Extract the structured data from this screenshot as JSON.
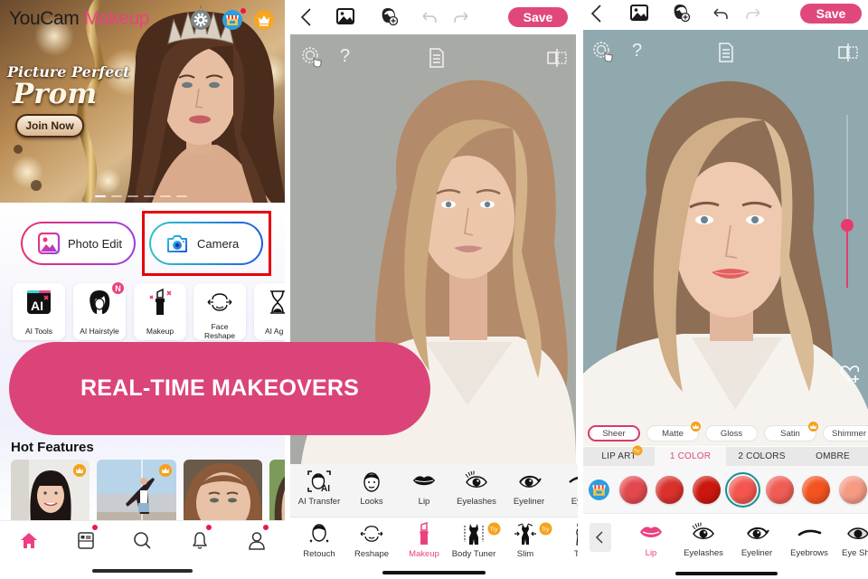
{
  "overlay_banner": {
    "text": "REAL-TIME MAKEOVERS",
    "color": "#db4479"
  },
  "colors": {
    "brand_pink": "#e0487c",
    "highlight_box": "#e8000b",
    "selected_ring": "#168f92",
    "premium_badge": "#f4a11d"
  },
  "home_screen": {
    "logo": {
      "part1": "YouCam",
      "part2": " Makeup"
    },
    "header_icons": [
      "settings-gear-icon",
      "store-icon",
      "premium-crown-icon"
    ],
    "hero": {
      "script_title": "Picture Perfect",
      "title": "Prom",
      "cta_label": "Join Now",
      "slide_count": 6,
      "active_slide": 1
    },
    "actions": [
      {
        "label": "Photo Edit",
        "icon": "photo-icon"
      },
      {
        "label": "Camera",
        "icon": "camera-icon",
        "highlighted": true
      }
    ],
    "features": [
      {
        "label": "AI Tools",
        "icon": "ai-tools-icon"
      },
      {
        "label": "AI Hairstyle",
        "icon": "hairstyle-icon",
        "badge": "N"
      },
      {
        "label": "Makeup",
        "icon": "lipstick-icon"
      },
      {
        "label_line1": "Face",
        "label_line2": "Reshape",
        "icon": "face-reshape-icon"
      },
      {
        "label": "AI Ag",
        "icon": "hourglass-icon"
      }
    ],
    "hot_features_title": "Hot Features",
    "hot_feature_cards": [
      {
        "premium": true
      },
      {
        "premium": true
      },
      {
        "premium": false
      },
      {
        "premium": false
      }
    ],
    "bottom_nav": [
      {
        "icon": "home-icon",
        "active": true
      },
      {
        "icon": "news-icon",
        "dot": true
      },
      {
        "icon": "search-icon"
      },
      {
        "icon": "bell-icon",
        "dot": true
      },
      {
        "icon": "profile-icon",
        "dot": true
      }
    ]
  },
  "editor_screen": {
    "save_label": "Save",
    "overlay_question": "?",
    "makeup_tools": [
      {
        "label": "AI Transfer"
      },
      {
        "label": "Looks"
      },
      {
        "label": "Lip"
      },
      {
        "label": "Eyelashes"
      },
      {
        "label": "Eyeliner"
      },
      {
        "label": "Eyel"
      }
    ],
    "categories": [
      {
        "label": "Retouch"
      },
      {
        "label": "Reshape"
      },
      {
        "label": "Makeup",
        "active": true
      },
      {
        "label": "Body Tuner",
        "badge": "Try"
      },
      {
        "label": "Slim",
        "badge": "Try"
      },
      {
        "label": "Tal"
      }
    ]
  },
  "lip_screen": {
    "save_label": "Save",
    "overlay_question": "?",
    "intensity_percent": 36,
    "finishes": [
      {
        "label": "Sheer",
        "selected": true
      },
      {
        "label": "Matte",
        "premium": true
      },
      {
        "label": "Gloss"
      },
      {
        "label": "Satin",
        "premium": true
      },
      {
        "label": "Shimmer"
      }
    ],
    "tabs": [
      {
        "label": "LIP ART",
        "badge": "Try"
      },
      {
        "label": "1 COLOR",
        "active": true
      },
      {
        "label": "2 COLORS"
      },
      {
        "label": "OMBRE"
      }
    ],
    "swatches": [
      {
        "color": "#e3484f"
      },
      {
        "color": "#d9312c"
      },
      {
        "color": "#cc170e"
      },
      {
        "color": "#f4564f",
        "selected": true
      },
      {
        "color": "#f05d55"
      },
      {
        "color": "#f4521f"
      },
      {
        "color": "#f69a84"
      }
    ],
    "tools": [
      {
        "label": "Lip",
        "active": true
      },
      {
        "label": "Eyelashes"
      },
      {
        "label": "Eyeliner"
      },
      {
        "label": "Eyebrows"
      },
      {
        "label": "Eye Sha"
      }
    ]
  }
}
